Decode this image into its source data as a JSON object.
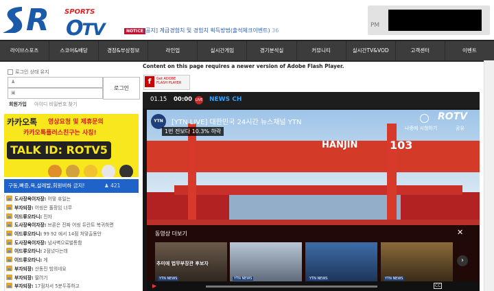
{
  "brand": {
    "logo_main": "ROTV",
    "logo_r": "R",
    "logo_tv": "TV",
    "logo_sports": "SPORTS"
  },
  "notice": {
    "badge": "NOTICE",
    "text": "[공지] 계급경험치 및 경험치 획득방법(출석체크이벤트)",
    "count": "36"
  },
  "user_box": {
    "label": "PM"
  },
  "nav": {
    "items": [
      "라이브스포츠",
      "스코어&배당",
      "경장&부상정보",
      "라인업",
      "실시간게임",
      "경기분석실",
      "커뮤니티",
      "실시간TV&VOD",
      "고객센터",
      "이벤트"
    ]
  },
  "login": {
    "remember": "로그인 상태 유지",
    "button": "로그인",
    "join": "회원가입",
    "find": "아이디 비밀번호 찾기"
  },
  "banner": {
    "brand": "카카오톡",
    "line1": "영상요청 및 제휴문의",
    "line2": "카카오톡플러스친구는 사칭!",
    "talk_id": "TALK ID: ROTV5"
  },
  "chat": {
    "title": "구동,빠증,욕,설레발,회원비하 금지!",
    "count": "421",
    "messages": [
      {
        "nick": "도사장욕이자장:",
        "msg": "어떻 휴일는"
      },
      {
        "nick": "부자되장:",
        "msg": "어씽은 풀정임 너무"
      },
      {
        "nick": "이드류오타니:",
        "msg": "진자"
      },
      {
        "nick": "도사장욕이자장:",
        "msg": "브론은 진짜 어씽 듀란트 복귀하면"
      },
      {
        "nick": "이드류오타니:",
        "msg": "99 92 에서 14점 처맞출동안"
      },
      {
        "nick": "도사장욕이자장:",
        "msg": "넘사벽으로벌통함"
      },
      {
        "nick": "이드류오타니:",
        "msg": "2점넜다는데"
      },
      {
        "nick": "이드류오타니:",
        "msg": "게"
      },
      {
        "nick": "부자되장:",
        "msg": "산동진 빙의네요"
      },
      {
        "nick": "부자되장:",
        "msg": "딸려기"
      },
      {
        "nick": "부자되장:",
        "msg": "17점차서 5분두쥬하고"
      }
    ]
  },
  "flash": {
    "message": "Content on this page requires a newer version of Adobe Flash Player.",
    "get_label": "Get ADOBE",
    "player_label": "FLASH PLAYER"
  },
  "player": {
    "date": "01.15",
    "time": "00:00",
    "live_dot": "LIVE",
    "channel": "NEWS CH",
    "ytn_logo": "YTN",
    "video_title": "[YTN LIVE] 대한민국 24시간 뉴스채널 YTN",
    "subtitle": "1번 전보다 10.3% 하락",
    "hanjin": "HANJIN",
    "hanjin_num": "103",
    "watch_later": "나중에 시청하기",
    "share": "공유",
    "watermark": "ROTV",
    "more_title": "동영상 더보기",
    "thumbs": [
      {
        "caption": "추미애 법무부장관 후보자",
        "tag": "YTN NEWS"
      },
      {
        "caption": "",
        "tag": "YTN NEWS"
      },
      {
        "caption": "",
        "tag": "YTN NEWS"
      },
      {
        "caption": "",
        "tag": "YTN NEWS"
      }
    ],
    "cc": "CC"
  },
  "colors": {
    "brand_blue": "#1a5aa8",
    "nav_bg": "#3c3c3c",
    "chat_header": "#1f63c8",
    "banner_yellow": "#f8e71c",
    "channel_blue": "#2fa3ff"
  }
}
